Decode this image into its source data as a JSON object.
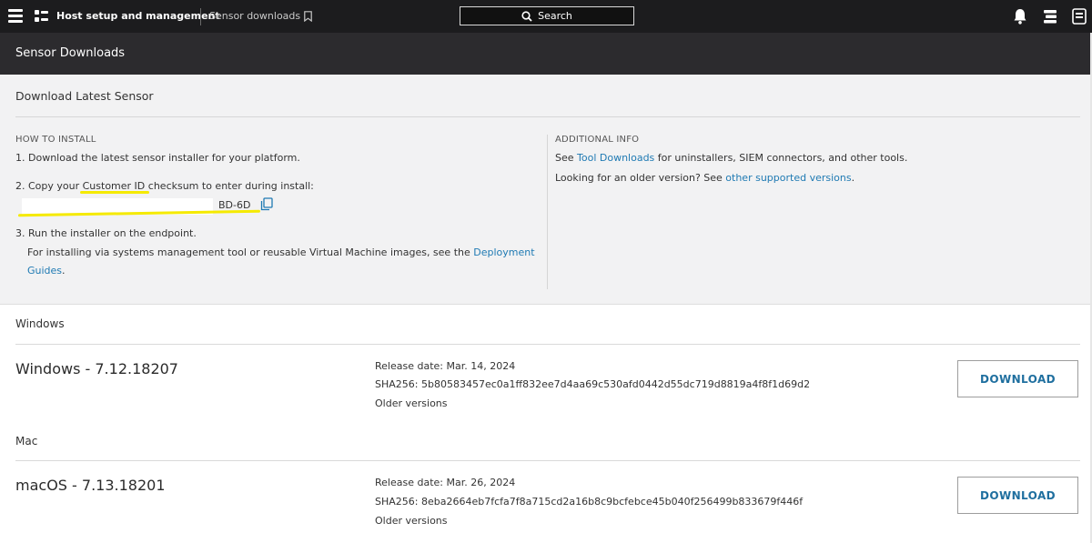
{
  "topbar": {
    "brand": "Host setup and management",
    "breadcrumb": "Sensor downloads",
    "search_label": "Search"
  },
  "header": {
    "title": "Sensor Downloads"
  },
  "info": {
    "title": "Download Latest Sensor",
    "how_to_install": {
      "heading": "HOW TO INSTALL",
      "step1": "1. Download the latest sensor installer for your platform.",
      "step2_prefix": "2. Copy your ",
      "step2_link": "Customer ID",
      "step2_suffix": " checksum to enter during install:",
      "checksum_visible": "BD-6D",
      "step3": "3. Run the installer on the endpoint.",
      "step3_detail_prefix": "For installing via systems management tool or reusable Virtual Machine images, see the ",
      "step3_link_a": "Deployment",
      "step3_link_b": "Guides",
      "step3_detail_suffix": "."
    },
    "additional": {
      "heading": "ADDITIONAL INFO",
      "line1_prefix": "See ",
      "line1_link": "Tool Downloads",
      "line1_suffix": " for uninstallers, SIEM connectors, and other tools.",
      "line2_prefix": "Looking for an older version? See ",
      "line2_link": "other supported versions",
      "line2_suffix": "."
    }
  },
  "downloads": [
    {
      "section": "Windows",
      "product": "Windows - 7.12.18207",
      "release": "Release date: Mar. 14, 2024",
      "sha": "SHA256: 5b80583457ec0a1ff832ee7d4aa69c530afd0442d55dc719d8819a4f8f1d69d2",
      "older": "Older versions",
      "button": "DOWNLOAD"
    },
    {
      "section": "Mac",
      "product": "macOS - 7.13.18201",
      "release": "Release date: Mar. 26, 2024",
      "sha": "SHA256: 8eba2664eb7fcfa7f8a715cd2a16b8c9bcfebce45b040f256499b833679f446f",
      "older": "Older versions",
      "button": "DOWNLOAD"
    }
  ],
  "colors": {
    "topbar_bg": "#1c1c1e",
    "header_bg": "#2c2b2e",
    "panel_bg": "#f2f2f3",
    "link": "#1f7ab3",
    "highlight": "#f5ea00"
  },
  "icons": [
    "menu-icon",
    "app-grid-icon",
    "bookmark-icon",
    "search-icon",
    "bell-icon",
    "notes-icon",
    "user-icon",
    "copy-icon"
  ]
}
